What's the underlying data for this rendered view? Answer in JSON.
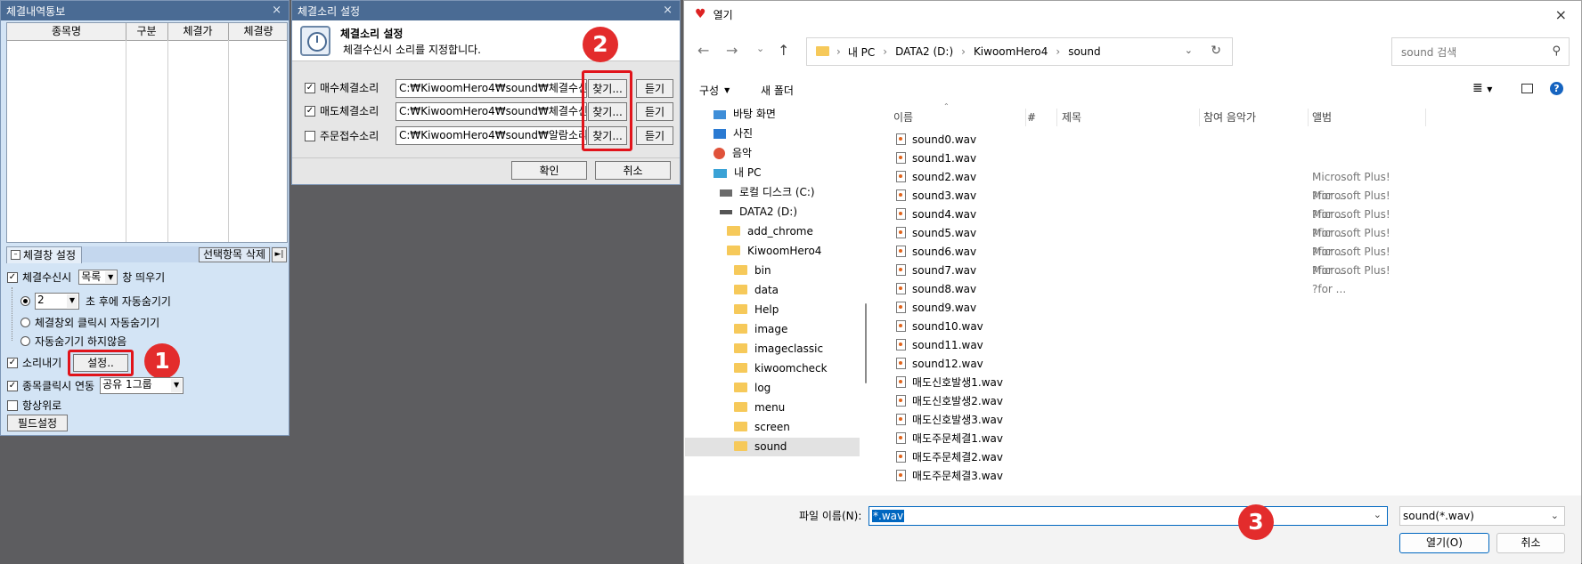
{
  "win1": {
    "title": "체결내역통보",
    "close": "×",
    "columns": [
      "종목명",
      "구분",
      "체결가",
      "체결량"
    ],
    "tab_label": "체결창 설정",
    "delete_button": "선택항목 삭제",
    "opt_popup_label": "체결수신시",
    "opt_popup_combo": "목록",
    "opt_popup_suffix": "창 띄우기",
    "opt_seconds_value": "2",
    "opt_seconds_suffix": "초 후에 자동숨기기",
    "opt_click_outside": "체결창외 클릭시 자동숨기기",
    "opt_no_hide": "자동숨기기 하지않음",
    "opt_sound": "소리내기",
    "settings_button": "설정..",
    "opt_link_label": "종목클릭시 연동",
    "opt_link_combo": "공유 1그룹",
    "opt_always_top": "항상위로",
    "field_button": "필드설정"
  },
  "win2": {
    "title": "체결소리 설정",
    "close": "×",
    "header_title": "체결소리 설정",
    "header_desc": "체결수신시 소리를 지정합니다.",
    "rows": [
      {
        "label": "매수체결소리",
        "path": "C:₩KiwoomHero4₩sound₩체결수신",
        "find": "찾기...",
        "listen": "듣기",
        "checked": true
      },
      {
        "label": "매도체결소리",
        "path": "C:₩KiwoomHero4₩sound₩체결수신",
        "find": "찾기...",
        "listen": "듣기",
        "checked": true
      },
      {
        "label": "주문접수소리",
        "path": "C:₩KiwoomHero4₩sound₩알람소리",
        "find": "찾기...",
        "listen": "듣기",
        "checked": false
      }
    ],
    "ok": "확인",
    "cancel": "취소"
  },
  "win3": {
    "title": "열기",
    "close": "×",
    "breadcrumb": [
      "내 PC",
      "DATA2 (D:)",
      "KiwoomHero4",
      "sound"
    ],
    "search_placeholder": "sound 검색",
    "organize": "구성",
    "new_folder": "새 폴더",
    "tree": [
      {
        "label": "바탕 화면",
        "icon": "desktop-icon"
      },
      {
        "label": "사진",
        "icon": "pictures-icon"
      },
      {
        "label": "음악",
        "icon": "music-icon"
      },
      {
        "label": "내 PC",
        "icon": "pc-icon"
      },
      {
        "label": "로컬 디스크 (C:)",
        "icon": "drive-icon"
      },
      {
        "label": "DATA2 (D:)",
        "icon": "drive-icon"
      },
      {
        "label": "add_chrome",
        "icon": "folder-icon"
      },
      {
        "label": "KiwoomHero4",
        "icon": "folder-icon"
      },
      {
        "label": "bin",
        "icon": "folder-icon"
      },
      {
        "label": "data",
        "icon": "folder-icon"
      },
      {
        "label": "Help",
        "icon": "folder-icon"
      },
      {
        "label": "image",
        "icon": "folder-icon"
      },
      {
        "label": "imageclassic",
        "icon": "folder-icon"
      },
      {
        "label": "kiwoomcheck",
        "icon": "folder-icon"
      },
      {
        "label": "log",
        "icon": "folder-icon"
      },
      {
        "label": "menu",
        "icon": "folder-icon"
      },
      {
        "label": "screen",
        "icon": "folder-icon"
      },
      {
        "label": "sound",
        "icon": "folder-icon"
      }
    ],
    "columns": [
      "이름",
      "#",
      "제목",
      "참여 음악가",
      "앨범"
    ],
    "files": [
      {
        "name": "sound0.wav",
        "album": ""
      },
      {
        "name": "sound1.wav",
        "album": ""
      },
      {
        "name": "sound2.wav",
        "album": "Microsoft Plus! ?for ..."
      },
      {
        "name": "sound3.wav",
        "album": "Microsoft Plus! ?for ..."
      },
      {
        "name": "sound4.wav",
        "album": "Microsoft Plus! ?for ..."
      },
      {
        "name": "sound5.wav",
        "album": "Microsoft Plus! ?for ..."
      },
      {
        "name": "sound6.wav",
        "album": "Microsoft Plus! ?for ..."
      },
      {
        "name": "sound7.wav",
        "album": "Microsoft Plus! ?for ..."
      },
      {
        "name": "sound8.wav",
        "album": ""
      },
      {
        "name": "sound9.wav",
        "album": ""
      },
      {
        "name": "sound10.wav",
        "album": ""
      },
      {
        "name": "sound11.wav",
        "album": ""
      },
      {
        "name": "sound12.wav",
        "album": ""
      },
      {
        "name": "매도신호발생1.wav",
        "album": ""
      },
      {
        "name": "매도신호발생2.wav",
        "album": ""
      },
      {
        "name": "매도신호발생3.wav",
        "album": ""
      },
      {
        "name": "매도주문체결1.wav",
        "album": ""
      },
      {
        "name": "매도주문체결2.wav",
        "album": ""
      },
      {
        "name": "매도주문체결3.wav",
        "album": ""
      }
    ],
    "filename_label": "파일 이름(N):",
    "filename_value": "*.wav",
    "filter_value": "sound(*.wav)",
    "open_button": "열기(O)",
    "cancel_button": "취소"
  },
  "badges": [
    "1",
    "2",
    "3"
  ],
  "colors": {
    "highlight_red": "#e1141b",
    "badge_red": "#e32c2c",
    "titlebar_blue": "#4a6b94"
  }
}
